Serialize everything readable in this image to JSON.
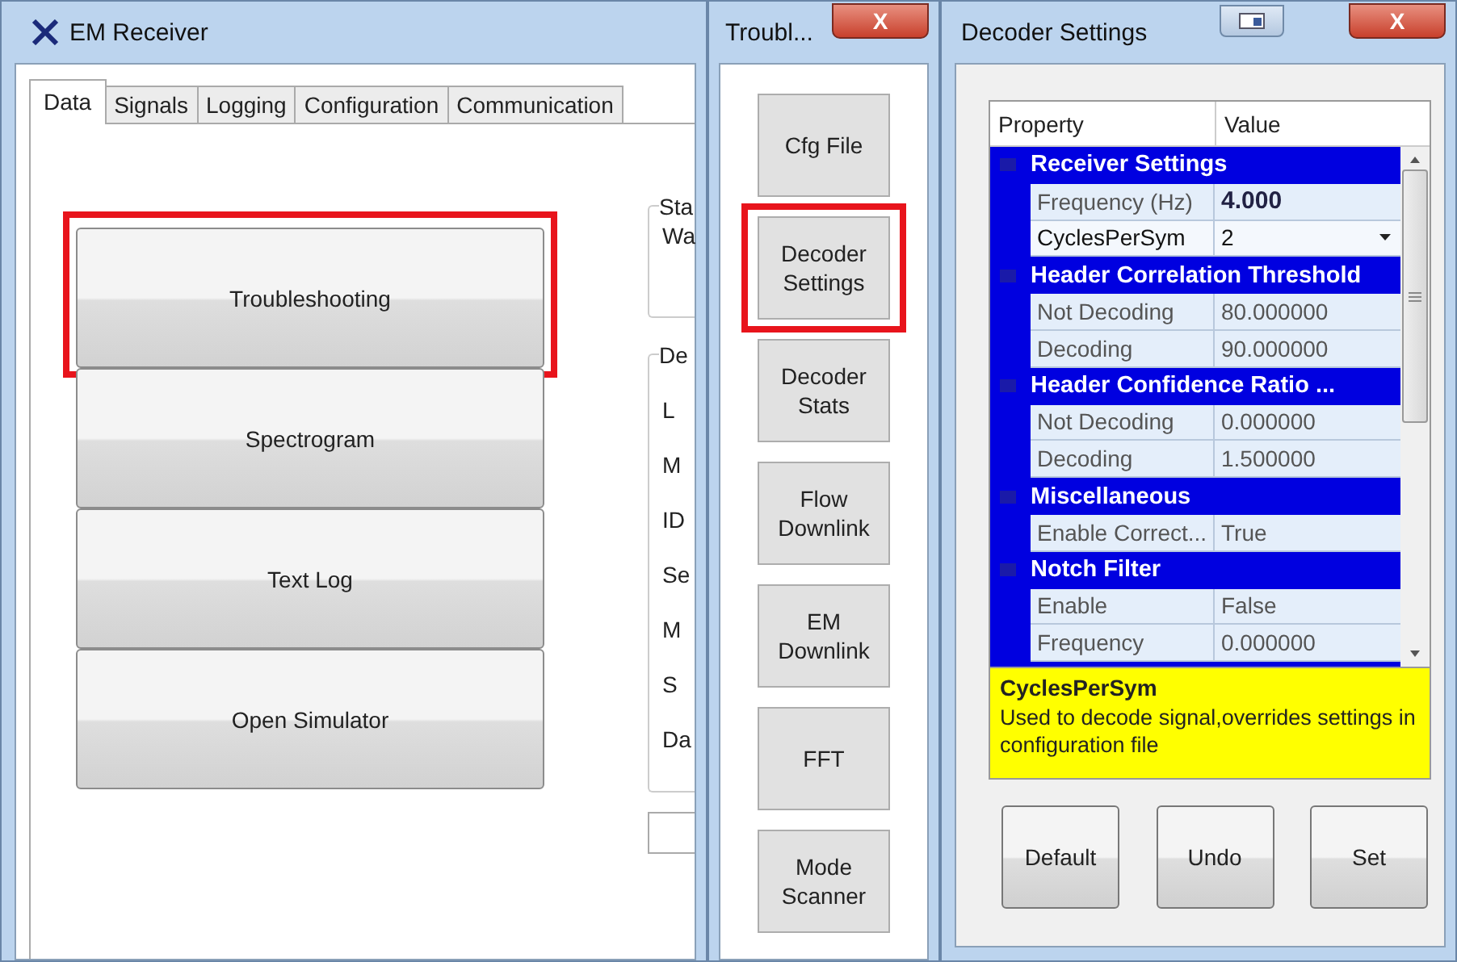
{
  "main_window": {
    "title": "EM Receiver",
    "tabs": [
      {
        "label": "Data",
        "selected": true
      },
      {
        "label": "Signals",
        "selected": false
      },
      {
        "label": "Logging",
        "selected": false
      },
      {
        "label": "Configuration",
        "selected": false
      },
      {
        "label": "Communication",
        "selected": false
      }
    ],
    "buttons": [
      {
        "label": "Troubleshooting",
        "highlighted": true
      },
      {
        "label": "Spectrogram",
        "highlighted": false
      },
      {
        "label": "Text Log",
        "highlighted": false
      },
      {
        "label": "Open Simulator",
        "highlighted": false
      }
    ],
    "status_group": {
      "legend": "Sta",
      "lines": [
        "Wa"
      ]
    },
    "decoder_group": {
      "legend": "De",
      "lines": [
        "L",
        "M",
        "ID",
        "Se",
        "M",
        "S",
        "Da"
      ]
    }
  },
  "troubleshooting_window": {
    "title": "Troubl...",
    "close": "X",
    "buttons": [
      {
        "label": "Cfg File",
        "highlighted": false
      },
      {
        "label": "Decoder Settings",
        "highlighted": true
      },
      {
        "label": "Decoder Stats",
        "highlighted": false
      },
      {
        "label": "Flow Downlink",
        "highlighted": false
      },
      {
        "label": "EM Downlink",
        "highlighted": false
      },
      {
        "label": "FFT",
        "highlighted": false
      },
      {
        "label": "Mode Scanner",
        "highlighted": false
      }
    ]
  },
  "decoder_window": {
    "title": "Decoder Settings",
    "close": "X",
    "grid": {
      "columns": [
        "Property",
        "Value"
      ],
      "rows": [
        {
          "kind": "category",
          "label": "Receiver Settings"
        },
        {
          "kind": "property",
          "name": "Frequency (Hz)",
          "value": "4.000",
          "modified": true,
          "selected": false
        },
        {
          "kind": "dropdown",
          "name": "CyclesPerSym",
          "value": "2",
          "modified": false,
          "selected": true
        },
        {
          "kind": "category",
          "label": "Header Correlation Threshold"
        },
        {
          "kind": "property",
          "name": "Not Decoding",
          "value": "80.000000",
          "modified": false,
          "selected": false
        },
        {
          "kind": "property",
          "name": "Decoding",
          "value": "90.000000",
          "modified": false,
          "selected": false
        },
        {
          "kind": "category",
          "label": "Header Confidence Ratio ..."
        },
        {
          "kind": "property",
          "name": "Not Decoding",
          "value": "0.000000",
          "modified": false,
          "selected": false
        },
        {
          "kind": "property",
          "name": "Decoding",
          "value": "1.500000",
          "modified": false,
          "selected": false
        },
        {
          "kind": "category",
          "label": "Miscellaneous"
        },
        {
          "kind": "property",
          "name": "Enable Correct...",
          "value": "True",
          "modified": false,
          "selected": false
        },
        {
          "kind": "category",
          "label": "Notch Filter"
        },
        {
          "kind": "property",
          "name": "Enable",
          "value": "False",
          "modified": false,
          "selected": false
        },
        {
          "kind": "property",
          "name": "Frequency",
          "value": "0.000000",
          "modified": false,
          "selected": false
        }
      ]
    },
    "help": {
      "title": "CyclesPerSym",
      "text": "Used to decode signal,overrides settings in configuration file"
    },
    "buttons": [
      "Default",
      "Undo",
      "Set"
    ]
  }
}
